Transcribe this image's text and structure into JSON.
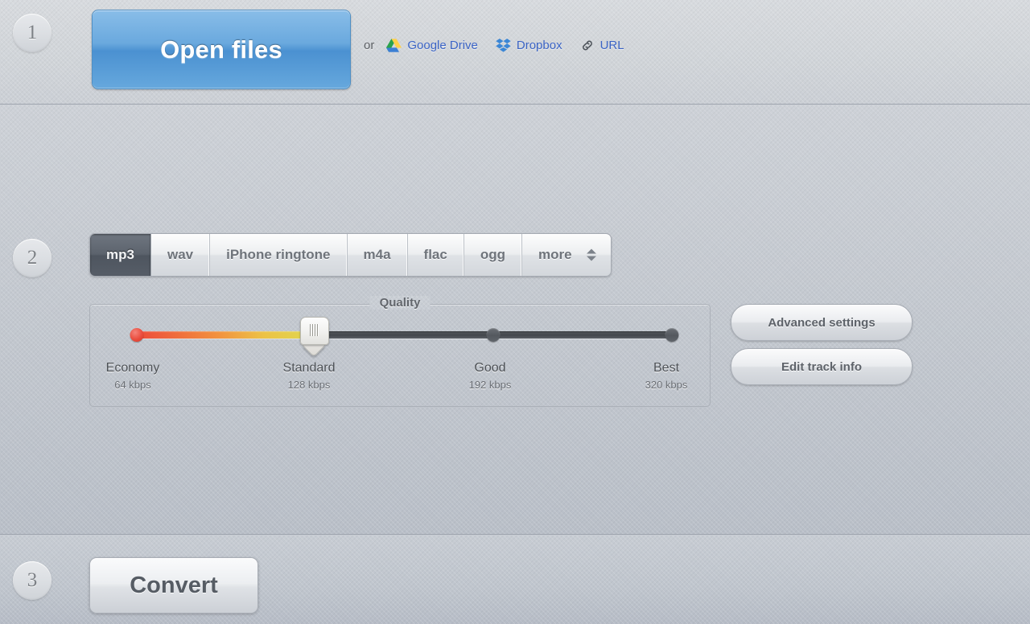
{
  "steps": {
    "one": "1",
    "two": "2",
    "three": "3"
  },
  "open_section": {
    "open_files_label": "Open files",
    "or_text": "or",
    "links": [
      {
        "label": "Google Drive",
        "icon": "google-drive-icon"
      },
      {
        "label": "Dropbox",
        "icon": "dropbox-icon"
      },
      {
        "label": "URL",
        "icon": "link-icon"
      }
    ]
  },
  "format_tabs": {
    "selected": "mp3",
    "items": [
      {
        "label": "mp3",
        "active": true
      },
      {
        "label": "wav",
        "active": false
      },
      {
        "label": "iPhone ringtone",
        "active": false
      },
      {
        "label": "m4a",
        "active": false
      },
      {
        "label": "flac",
        "active": false
      },
      {
        "label": "ogg",
        "active": false
      },
      {
        "label": "more",
        "active": false
      }
    ]
  },
  "quality": {
    "legend": "Quality",
    "selected_index": 1,
    "selected_name": "Standard",
    "selected_rate": "128 kbps",
    "stops": [
      {
        "name": "Economy",
        "rate": "64 kbps",
        "pos_pct": 0
      },
      {
        "name": "Standard",
        "rate": "128 kbps",
        "pos_pct": 33.2
      },
      {
        "name": "Good",
        "rate": "192 kbps",
        "pos_pct": 66.5
      },
      {
        "name": "Best",
        "rate": "320 kbps",
        "pos_pct": 100
      }
    ],
    "fill_color_start": "#ec4a3b",
    "fill_color_end": "#dfd84f",
    "track_color": "#4a4e54"
  },
  "side_buttons": {
    "advanced_settings": "Advanced settings",
    "edit_track_info": "Edit track info"
  },
  "convert_section": {
    "convert_label": "Convert"
  },
  "colors": {
    "accent_blue": "#5a9ad6",
    "link_blue": "#3a63c4",
    "page_bg": "#c3c8cf"
  }
}
